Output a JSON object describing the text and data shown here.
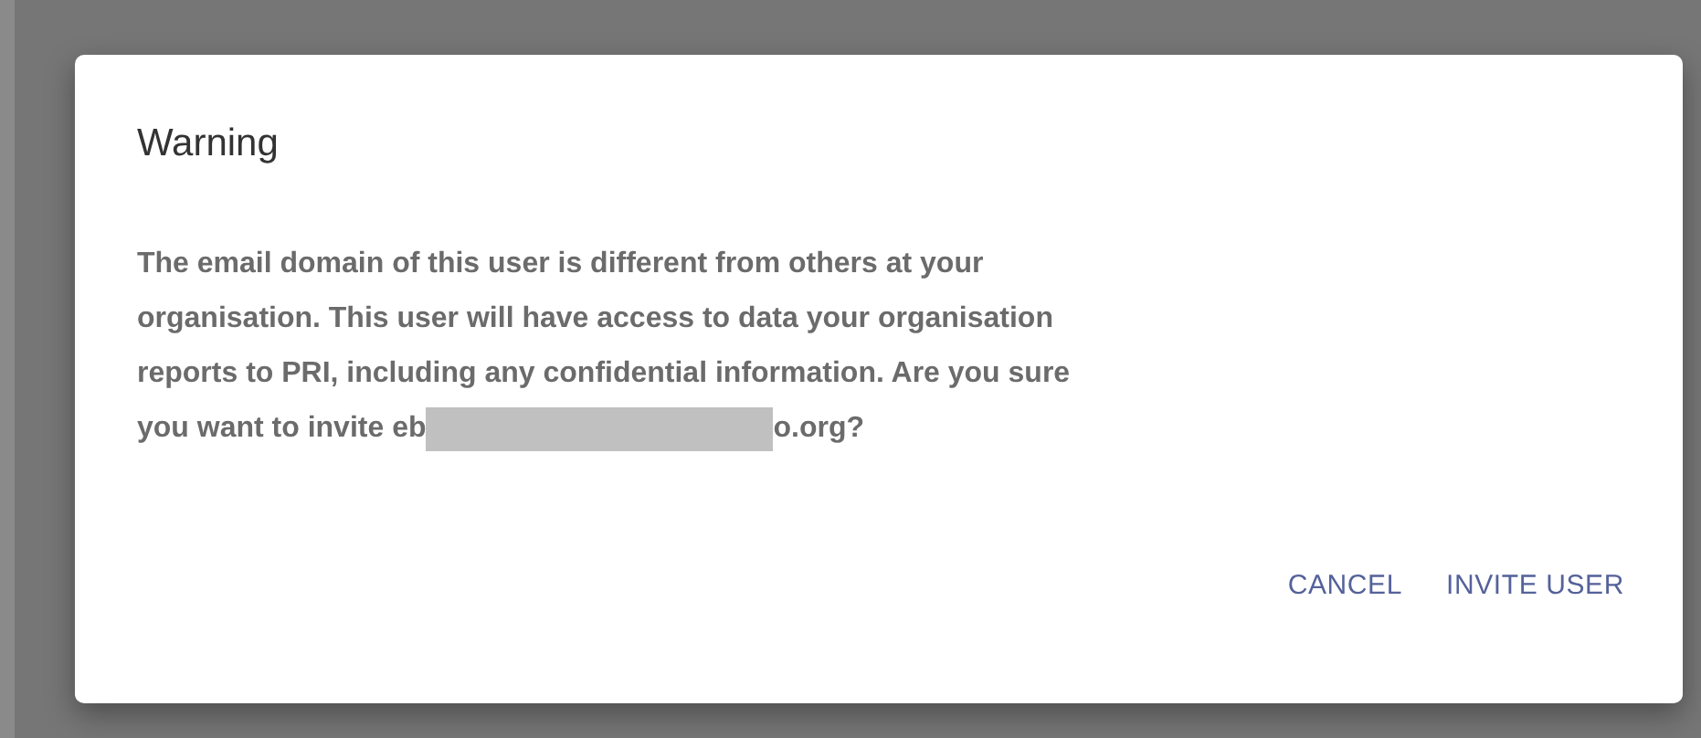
{
  "dialog": {
    "title": "Warning",
    "lines": [
      [
        {
          "kind": "text",
          "text": "The email domain of this user is different from others at your"
        }
      ],
      [
        {
          "kind": "text",
          "text": "organisation. This user will have access to data your organisation"
        }
      ],
      [
        {
          "kind": "text",
          "text": "reports to PRI, including any confidential information. Are you sure"
        }
      ],
      [
        {
          "kind": "text",
          "text": "you want to invite eb"
        },
        {
          "kind": "redacted"
        },
        {
          "kind": "text",
          "text": "o.org?"
        }
      ]
    ],
    "buttons": [
      "CANCEL",
      "INVITE USER"
    ]
  }
}
